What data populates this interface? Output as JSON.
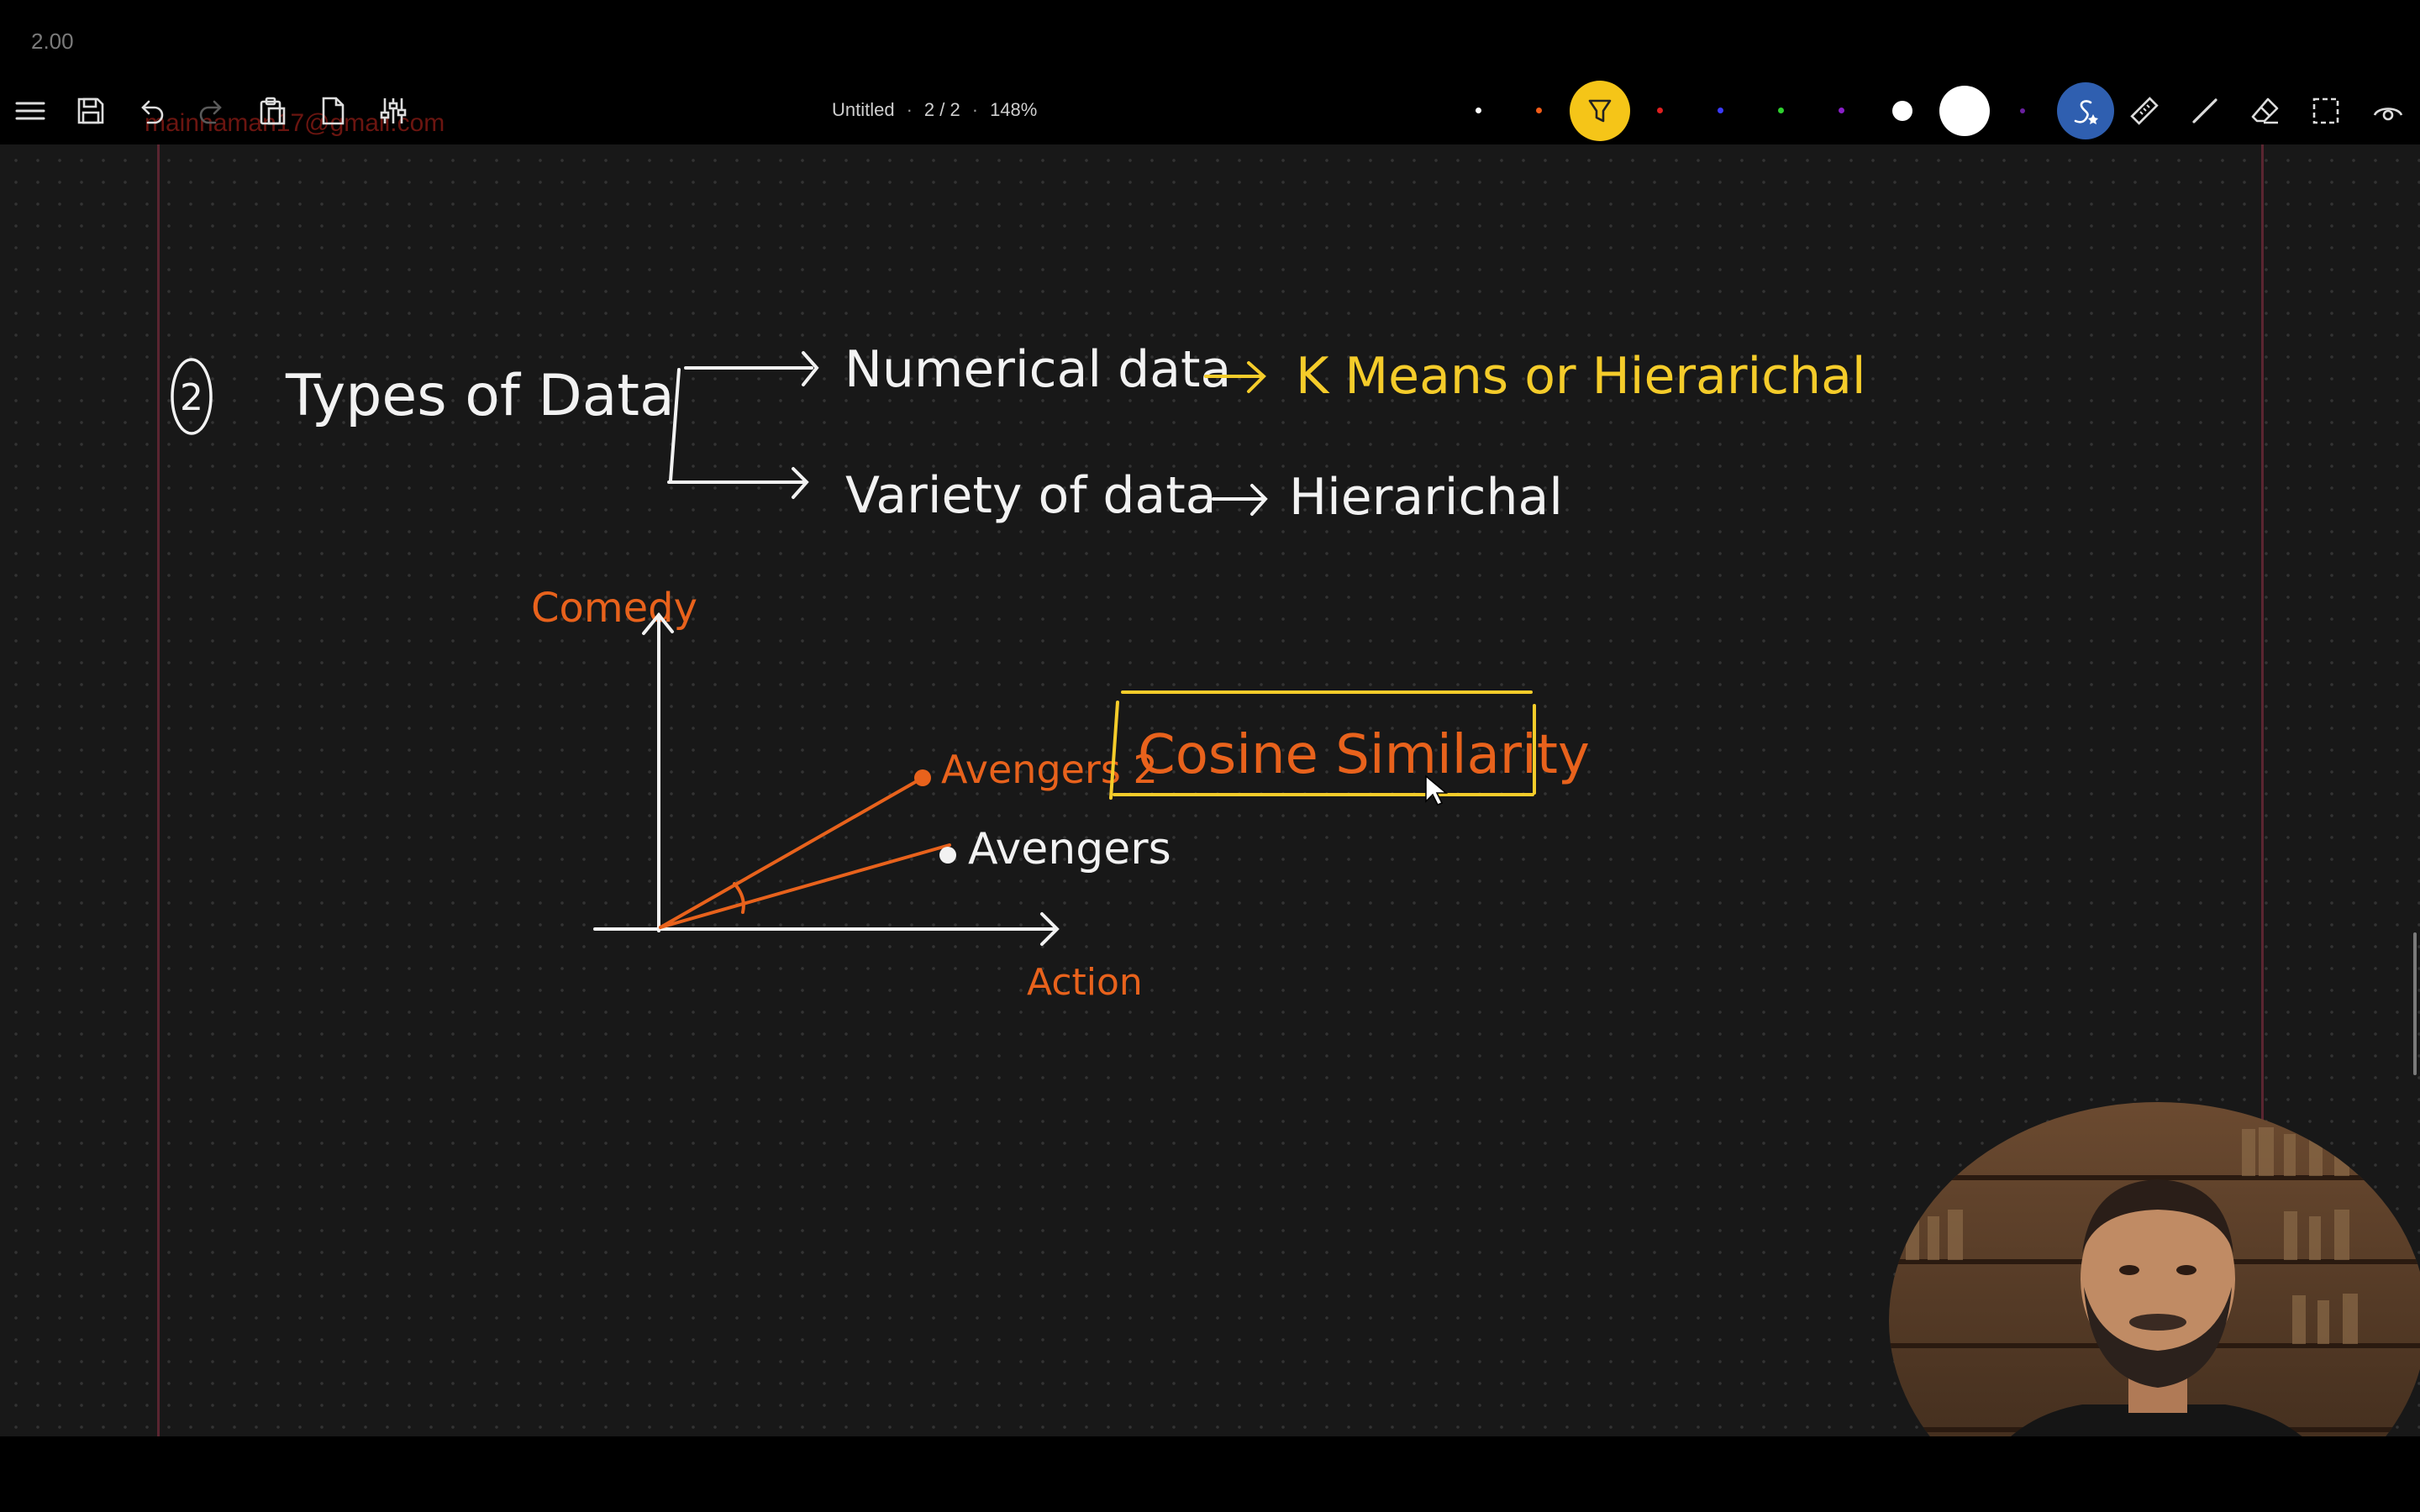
{
  "player": {
    "speed": "2.00"
  },
  "watermark": "mainnaman17@gmail.com",
  "toolbar": {
    "menu_icon": "hamburger-icon",
    "left_tools": [
      "save-icon",
      "undo-icon",
      "redo-icon",
      "clipboard-icon",
      "page-icon",
      "settings-sliders-icon"
    ],
    "doc_title": "Untitled",
    "page_indicator": "2 / 2",
    "zoom": "148%",
    "pen_colors": [
      "#ffffff",
      "#f25c18",
      "#ffd400",
      "#e02020",
      "#3a3aff",
      "#2ed12e",
      "#8a1ec9"
    ],
    "selected_color": "#f5c518",
    "right_tools": [
      "shape-recognition-icon",
      "ruler-icon",
      "line-icon",
      "eraser-icon",
      "selection-icon",
      "view-icon"
    ]
  },
  "board": {
    "section_number": "2",
    "heading": "Types of Data",
    "branch1_label": "Numerical data",
    "branch1_result": "K Means or Hierarichal",
    "branch2_label": "Variety of data",
    "branch2_result": "Hierarichal",
    "y_axis_label": "Comedy",
    "x_axis_label": "Action",
    "point1_label": "Avengers 2",
    "point2_label": "Avengers",
    "boxed_term": "Cosine Similarity",
    "ink_colors": {
      "white": "#f2f2f2",
      "yellow": "#f5cc2a",
      "orange": "#e8621c"
    }
  },
  "webcam": {
    "alt": "presenter-webcam"
  }
}
